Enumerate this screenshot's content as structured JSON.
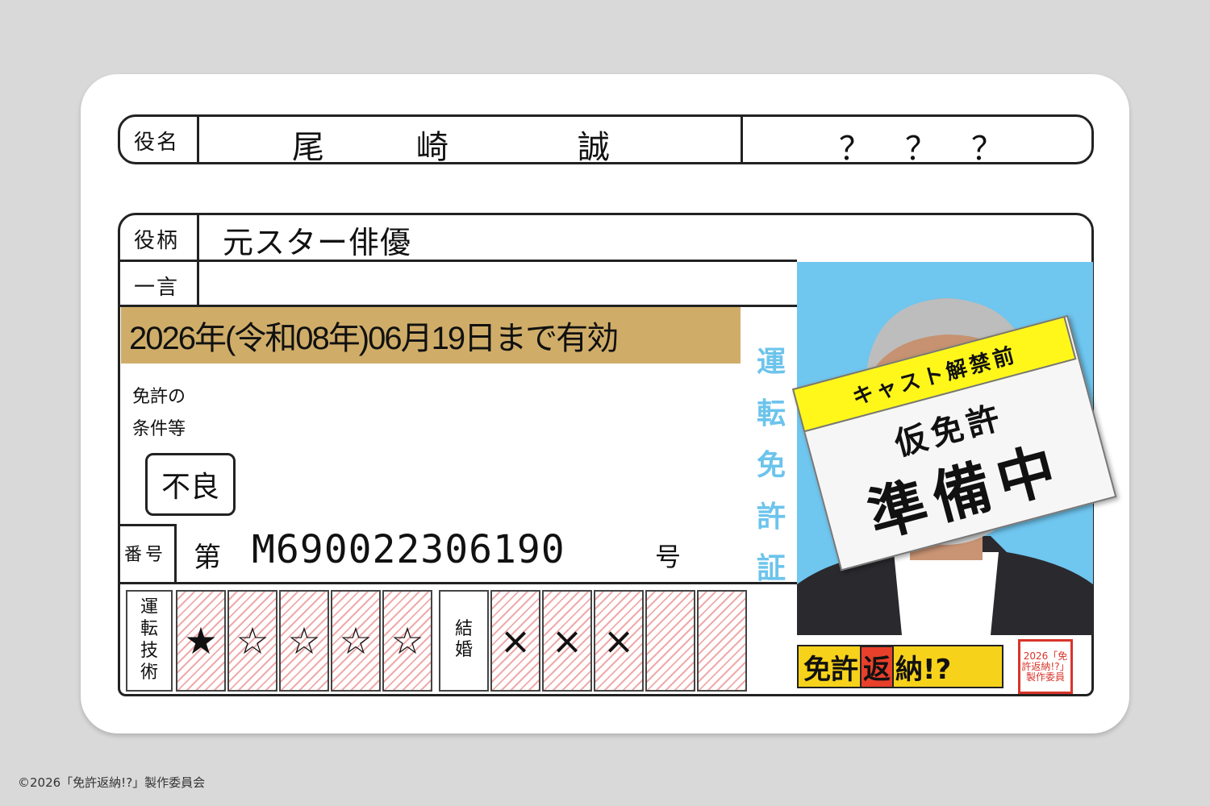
{
  "card": {
    "role_name_label": "役名",
    "name_chars": [
      "尾",
      "崎",
      "誠"
    ],
    "unknown_marks": [
      "？",
      "？",
      "？"
    ],
    "role_type_label": "役柄",
    "role_type_value": "元スター俳優",
    "comment_label": "一言",
    "comment_value": "",
    "validity": "2026年(令和08年)06月19日まで有効",
    "conditions_label_line1": "免許の",
    "conditions_label_line2": "条件等",
    "condition_stamp": "不良",
    "number_label": "番号",
    "number_prefix": "第",
    "number_value": "M690022306190",
    "number_suffix": "号",
    "license_title_chars": [
      "運",
      "転",
      "免",
      "許",
      "証"
    ],
    "skill_label": "運転技術",
    "skill_stars": [
      "★",
      "☆",
      "☆",
      "☆",
      "☆"
    ],
    "marriage_label": "結婚",
    "marriage_marks": [
      "×",
      "×",
      "×",
      "",
      ""
    ]
  },
  "sticker": {
    "band": "キャスト解禁前",
    "line1": "仮免許",
    "line2": "準備中"
  },
  "logo": {
    "pre": "免許",
    "highlight": "返",
    "post": "納!?"
  },
  "seal_text": "2026「免許返納!?」製作委員",
  "copyright": "©2026「免許返納!?」製作委員会",
  "colors": {
    "background": "#d9d9d9",
    "validity_band": "#cfad69",
    "license_title": "#6cc4ec",
    "photo_bg": "#6fc6ef",
    "sticker_band": "#fff71a",
    "logo_bg": "#f7d21b",
    "seal": "#d8352a"
  }
}
